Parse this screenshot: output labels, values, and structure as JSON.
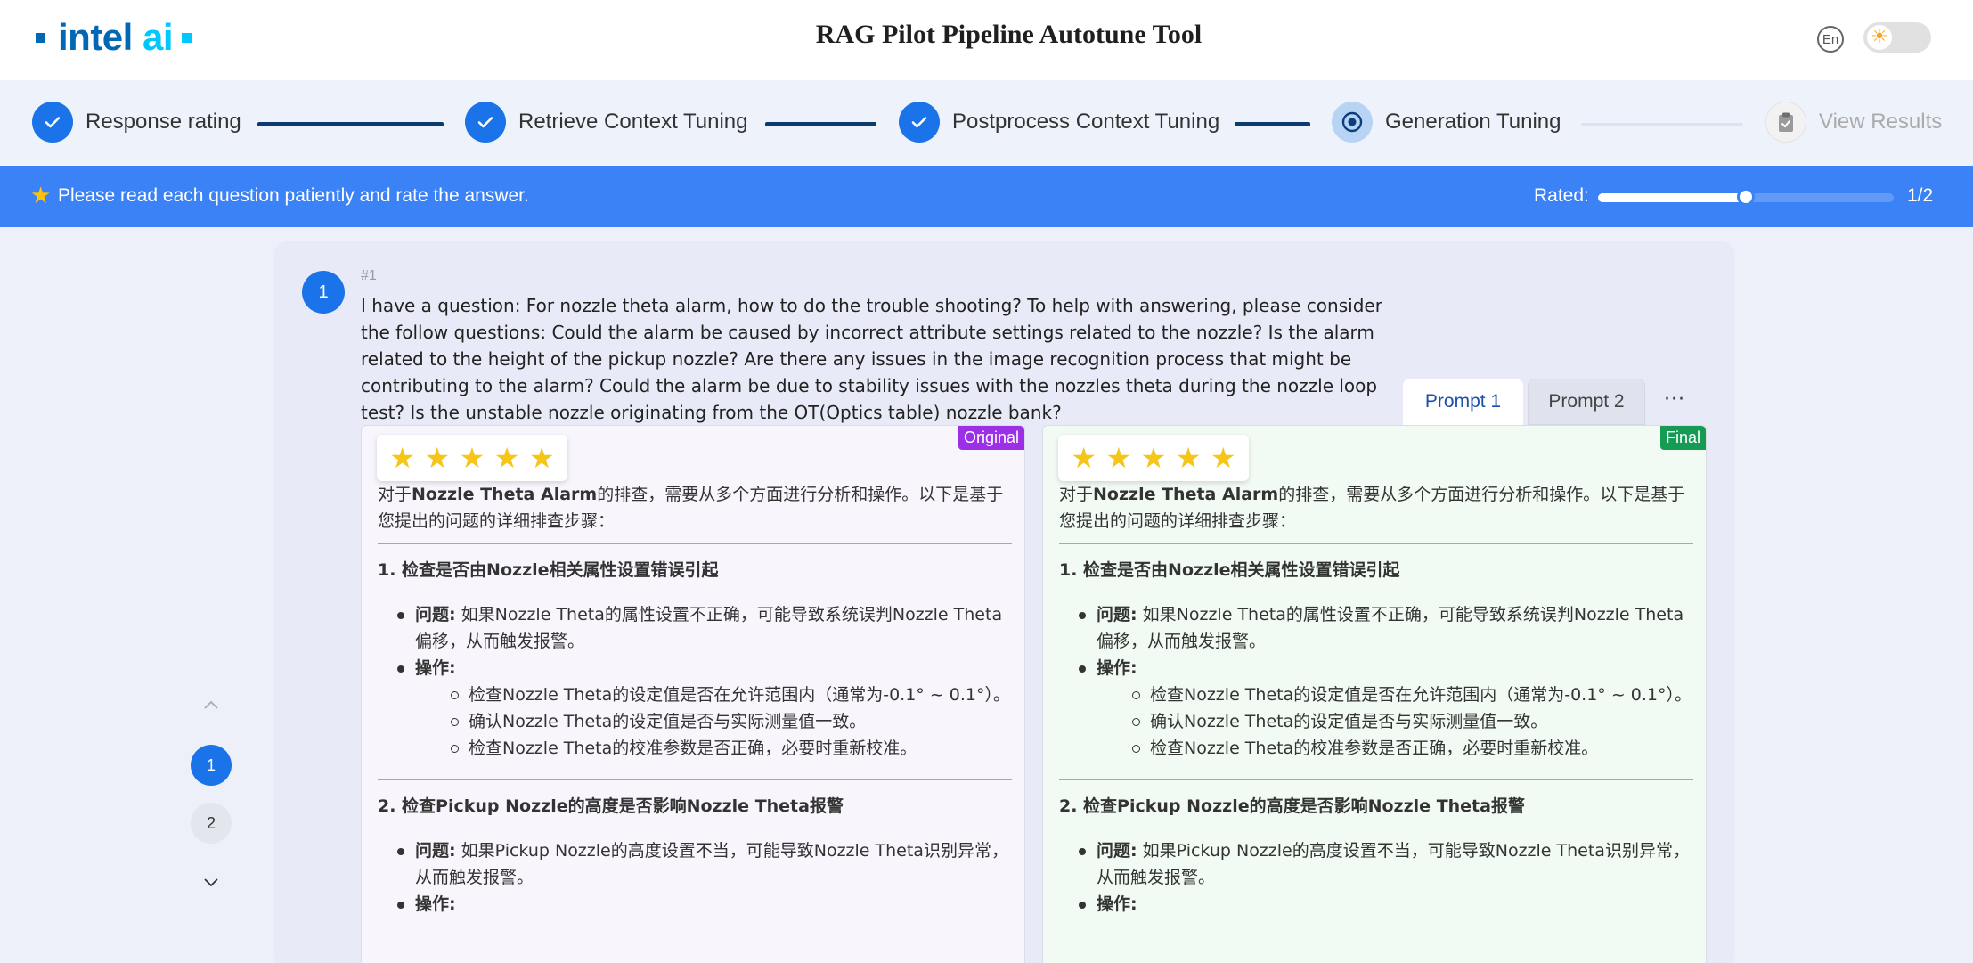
{
  "header": {
    "logo_primary": "intel",
    "logo_accent": "ai",
    "title": "RAG Pilot Pipeline Autotune Tool",
    "lang_label": "En"
  },
  "stepper": {
    "steps": [
      {
        "label": "Response rating",
        "status": "done"
      },
      {
        "label": "Retrieve Context Tuning",
        "status": "done"
      },
      {
        "label": "Postprocess Context Tuning",
        "status": "done"
      },
      {
        "label": "Generation Tuning",
        "status": "active"
      },
      {
        "label": "View Results",
        "status": "pending"
      }
    ]
  },
  "banner": {
    "message": "Please read each question patiently and rate the answer.",
    "rated_label": "Rated:",
    "rated_count": "1/2",
    "rated_progress": 0.5
  },
  "pager": {
    "items": [
      "1",
      "2"
    ],
    "active": "1"
  },
  "question": {
    "badge": "1",
    "number": "#1",
    "text": "I have a question: For nozzle theta alarm, how to do the trouble shooting? To help with answering, please consider the follow questions: Could the alarm be caused by incorrect attribute settings related to the nozzle? Is the alarm related to the height of the pickup nozzle? Are there any issues in the image recognition process that might be contributing to the alarm? Could the alarm be due to stability issues with the nozzles theta during the nozzle loop test? Is the unstable nozzle originating from the OT(Optics table) nozzle bank?"
  },
  "tabs": {
    "items": [
      "Prompt 1",
      "Prompt 2"
    ],
    "active": "Prompt 1",
    "more": "···"
  },
  "answers": {
    "original": {
      "tag": "Original",
      "rating": 5,
      "intro_pre": "对于",
      "intro_bold": "Nozzle Theta Alarm",
      "intro_post": "的排查，需要从多个方面进行分析和操作。以下是基于您提出的问题的详细排查步骤：",
      "s1_title": "1. 检查是否由Nozzle相关属性设置错误引起",
      "s1_issue_label": "问题:",
      "s1_issue": " 如果Nozzle Theta的属性设置不正确，可能导致系统误判Nozzle Theta偏移，从而触发报警。",
      "s1_action_label": "操作:",
      "s1_actions": [
        "检查Nozzle Theta的设定值是否在允许范围内（通常为-0.1° ~ 0.1°）。",
        "确认Nozzle Theta的设定值是否与实际测量值一致。",
        "检查Nozzle Theta的校准参数是否正确，必要时重新校准。"
      ],
      "s2_title": "2. 检查Pickup Nozzle的高度是否影响Nozzle Theta报警",
      "s2_issue_label": "问题:",
      "s2_issue": " 如果Pickup Nozzle的高度设置不当，可能导致Nozzle Theta识别异常，从而触发报警。",
      "s2_action_label": "操作:"
    },
    "final": {
      "tag": "Final",
      "rating": 5,
      "intro_pre": "对于",
      "intro_bold": "Nozzle Theta Alarm",
      "intro_post": "的排查，需要从多个方面进行分析和操作。以下是基于您提出的问题的详细排查步骤：",
      "s1_title": "1. 检查是否由Nozzle相关属性设置错误引起",
      "s1_issue_label": "问题:",
      "s1_issue": " 如果Nozzle Theta的属性设置不正确，可能导致系统误判Nozzle Theta偏移，从而触发报警。",
      "s1_action_label": "操作:",
      "s1_actions": [
        "检查Nozzle Theta的设定值是否在允许范围内（通常为-0.1° ~ 0.1°）。",
        "确认Nozzle Theta的设定值是否与实际测量值一致。",
        "检查Nozzle Theta的校准参数是否正确，必要时重新校准。"
      ],
      "s2_title": "2. 检查Pickup Nozzle的高度是否影响Nozzle Theta报警",
      "s2_issue_label": "问题:",
      "s2_issue": " 如果Pickup Nozzle的高度设置不当，可能导致Nozzle Theta识别异常，从而触发报警。",
      "s2_action_label": "操作:"
    }
  },
  "colors": {
    "primary": "#1a73e8",
    "banner": "#3b82f6",
    "original_tag": "#9b30e6",
    "final_tag": "#169b55",
    "star": "#f5c518"
  }
}
